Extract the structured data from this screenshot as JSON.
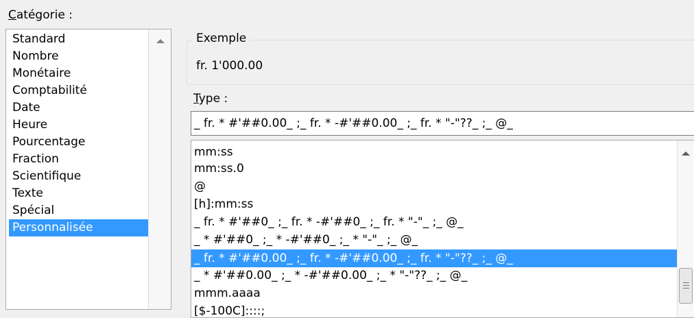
{
  "categorie": {
    "label": "Catégorie :",
    "label_accel": "C",
    "label_rest": "atégorie :",
    "items": [
      "Standard",
      "Nombre",
      "Monétaire",
      "Comptabilité",
      "Date",
      "Heure",
      "Pourcentage",
      "Fraction",
      "Scientifique",
      "Texte",
      "Spécial",
      "Personnalisée"
    ],
    "selected": "Personnalisée"
  },
  "exemple": {
    "title": "Exemple",
    "value": "fr. 1'000.00"
  },
  "type": {
    "label": "Type :",
    "label_accel": "T",
    "label_rest": "ype :",
    "value": "_ fr. * #'##0.00_ ;_ fr. * -#'##0.00_ ;_ fr. * \"-\"??_ ;_ @_"
  },
  "formats": {
    "items": [
      "mm:ss",
      "mm:ss.0",
      "@",
      "[h]:mm:ss",
      "_ fr. * #'##0_ ;_ fr. * -#'##0_ ;_ fr. * \"-\"_ ;_ @_",
      "_ * #'##0_ ;_ * -#'##0_ ;_ * \"-\"_ ;_ @_",
      "_ fr. * #'##0.00_ ;_ fr. * -#'##0.00_ ;_ fr. * \"-\"??_ ;_ @_",
      "_ * #'##0.00_ ;_ * -#'##0.00_ ;_ * \"-\"??_ ;_ @_",
      "mmm.aaaa",
      "[$-100C]::::;"
    ],
    "selected_index": 6
  },
  "colors": {
    "selection": "#3399ff",
    "dialog_bg": "#f0f0f0"
  }
}
